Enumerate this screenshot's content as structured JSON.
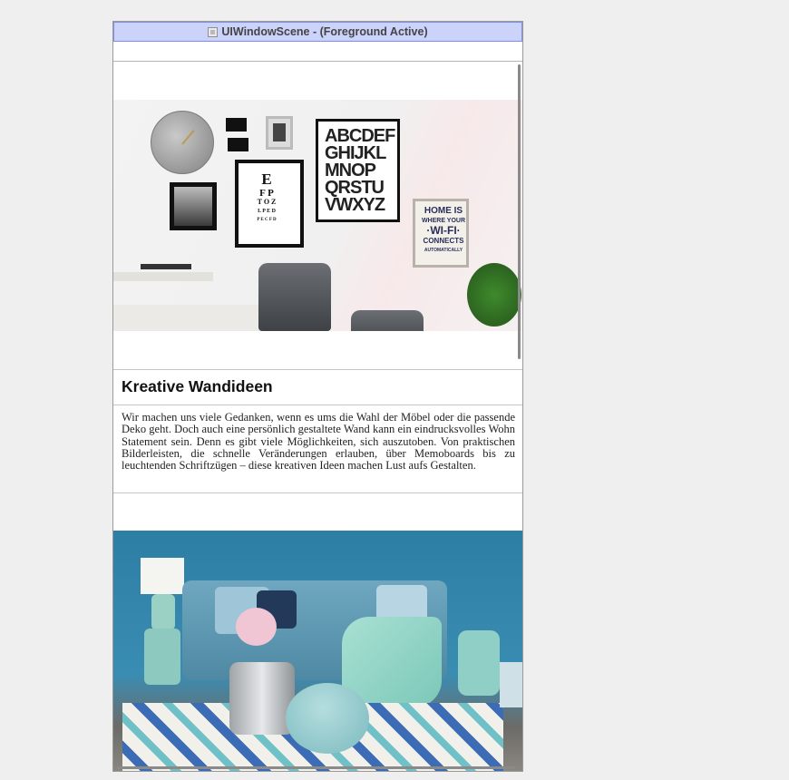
{
  "window": {
    "title": "UIWindowScene - (Foreground Active)",
    "title_icon": "scene-icon"
  },
  "article": {
    "image1_alt": "gallery-wall-photo",
    "heading": "Kreative Wandideen",
    "body": "Wir machen uns viele Gedanken, wenn es ums die Wahl der Möbel oder die passende Deko geht. Doch auch eine persönlich gestaltete Wand kann ein eindrucksvolles Wohn Statement sein. Denn es gibt viele Möglichkeiten, sich auszutoben. Von praktischen Bilderleisten, die schnelle Veränderungen erlauben, über Memoboards bis zu leuchtenden Schriftzügen – diese kreativen Ideen machen Lust aufs Gestalten.",
    "image2_alt": "living-room-photo"
  },
  "wall_art": {
    "eye_chart": [
      "E",
      "F P",
      "T O Z",
      "L P E D",
      "P E C F D"
    ],
    "alphabet_poster": [
      "ABCDEF",
      "GHIJKL",
      "MNOP",
      "QRSTU",
      "VWXYZ"
    ],
    "wifi_sign": [
      "HOME IS",
      "WHERE YOUR",
      "·WI-FI·",
      "CONNECTS",
      "AUTOMATICALLY"
    ]
  },
  "colors": {
    "titlebar": "#ccd3fb",
    "titlebar_border": "#7f8fe8",
    "background": "#efefef",
    "room_wall": "#2d7ea5"
  }
}
